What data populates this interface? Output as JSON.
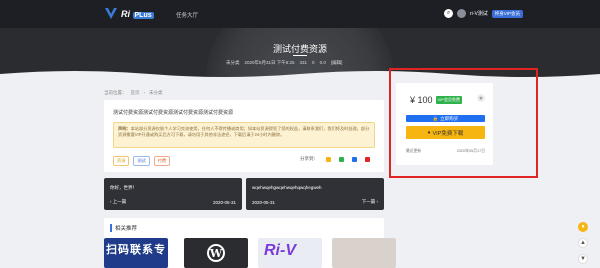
{
  "nav": {
    "logo_text": "Ri",
    "logo_badge": "PLus",
    "menu_item": "任务大厅",
    "username": "ri-V测试",
    "user_badge": "终身VIP会员"
  },
  "hero": {
    "title": "测试付费资源",
    "meta": [
      "未分类",
      "2020年5月31日 下午6:25",
      "331",
      "0",
      "0.0",
      "[编辑]"
    ]
  },
  "breadcrumb": {
    "label": "当前位置：",
    "home": "首页",
    "category": "未分类"
  },
  "post": {
    "body": "测试付费资源测试付费资源测试付费资源测试付费资源",
    "notice_label": "声明：",
    "notice": "本站部分资源仅限个人学习交流使用，任何人不得传播或商用；如本站资源侵犯了您的权益，请联系我们，我们将及时处理。部分资源需要VIP开通或购买后方可下载，请勿用于其他非法途径，下载后请于24小时内删除。",
    "tags": [
      "资源",
      "测试",
      "付费",
      "下载"
    ],
    "share_label": "分享到："
  },
  "prev_next": {
    "prev_title": "你好，世界！",
    "prev_label": "上一篇",
    "prev_date": "2020-05-31",
    "next_title": "wqehwqehgwqehwqehqwqhegweh",
    "next_label": "下一篇",
    "next_date": "2020-05-31"
  },
  "related": {
    "title": "相关推荐",
    "thumb1_text": "扫码联系专",
    "thumb3_text": "Ri-V"
  },
  "purchase": {
    "price": "¥ 100",
    "vip_tag": "VIP会员免费",
    "buy_label": "立即购买",
    "vip_download_label": "VIP免费下载",
    "update_label": "最近更新",
    "update_date": "2020年05月17日"
  },
  "colors": {
    "accent": "#1f6ff0",
    "vip": "#f6b511",
    "highlight": "#e02424",
    "nav_bg": "#1d1f24"
  }
}
